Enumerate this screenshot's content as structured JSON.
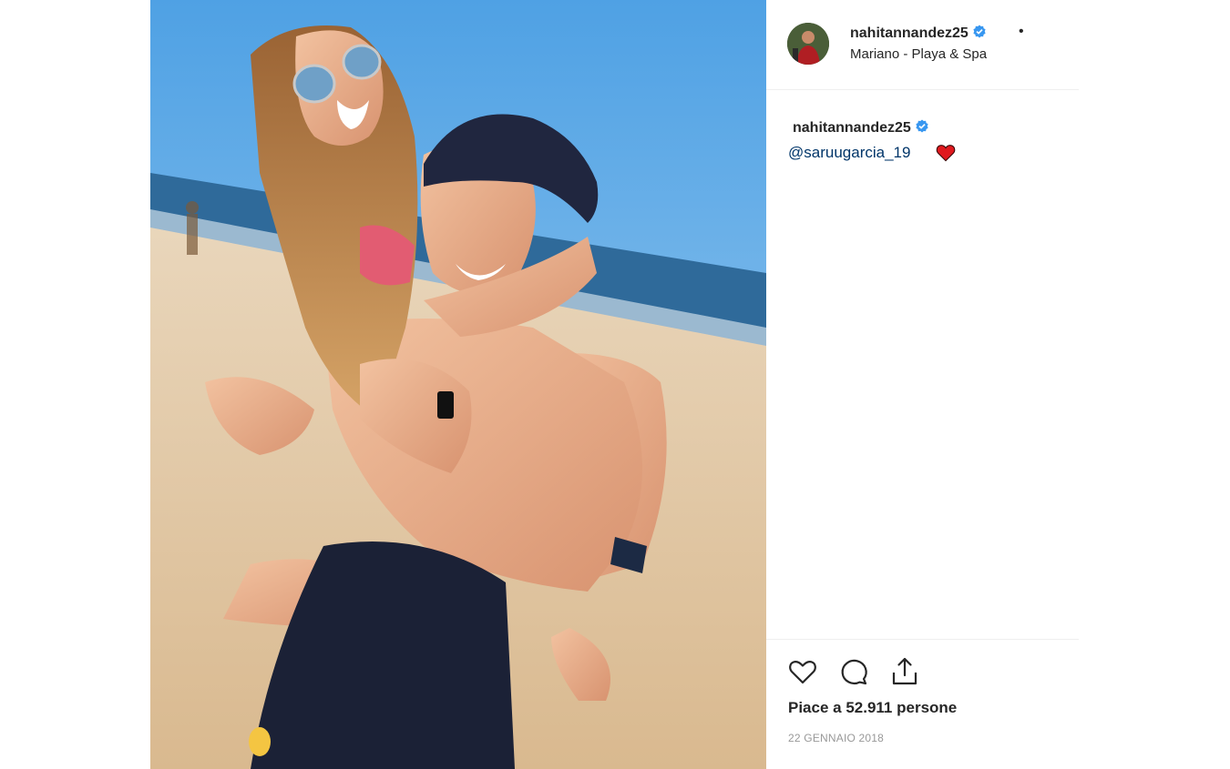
{
  "header": {
    "username": "nahitannandez25",
    "separator": "•",
    "location": "Mariano - Playa & Spa"
  },
  "caption": {
    "username": "nahitannandez25",
    "mention": "@saruugarcia_19"
  },
  "actions": {
    "like_icon": "heart-outline-icon",
    "comment_icon": "speech-bubble-icon",
    "share_icon": "share-upload-icon"
  },
  "likes": {
    "text": "Piace a 52.911 persone"
  },
  "date": {
    "text": "22 GENNAIO 2018"
  },
  "colors": {
    "verified": "#3897f0",
    "mention": "#003569",
    "text": "#262626",
    "muted": "#999999",
    "divider": "#efefef",
    "heart_emoji": "#e0191e"
  }
}
